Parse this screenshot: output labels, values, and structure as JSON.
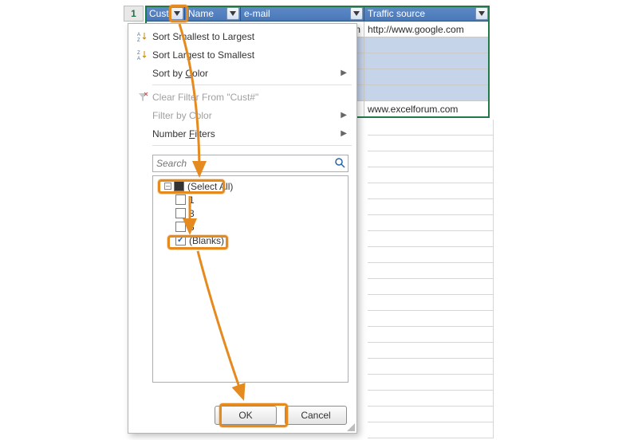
{
  "sheet": {
    "row_label": "1",
    "headers": {
      "cust": "Cust#",
      "name": "Name",
      "email": "e-mail",
      "traffic": "Traffic source"
    },
    "rows": [
      {
        "traffic": "http://www.google.com",
        "selected": false,
        "after_email": "m"
      },
      {
        "traffic": "",
        "selected": true
      },
      {
        "traffic": "",
        "selected": true
      },
      {
        "traffic": "",
        "selected": true
      },
      {
        "traffic": "",
        "selected": true
      },
      {
        "traffic": "www.excelforum.com",
        "selected": false
      }
    ]
  },
  "menu": {
    "sort_asc": "Sort Smallest to Largest",
    "sort_desc": "Sort Largest to Smallest",
    "sort_color_pre": "Sort by ",
    "sort_color_accel": "C",
    "sort_color_post": "olor",
    "clear_filter": "Clear Filter From \"Cust#\"",
    "filter_color": "Filter by Color",
    "num_filters_pre": "Number ",
    "num_filters_accel": "F",
    "num_filters_post": "ilters"
  },
  "search": {
    "placeholder": "Search"
  },
  "checklist": {
    "select_all": "(Select All)",
    "items": [
      "1",
      "3",
      "5"
    ],
    "blanks": "(Blanks)"
  },
  "buttons": {
    "ok": "OK",
    "cancel": "Cancel"
  },
  "colors": {
    "annotation": "#e58a1f"
  }
}
